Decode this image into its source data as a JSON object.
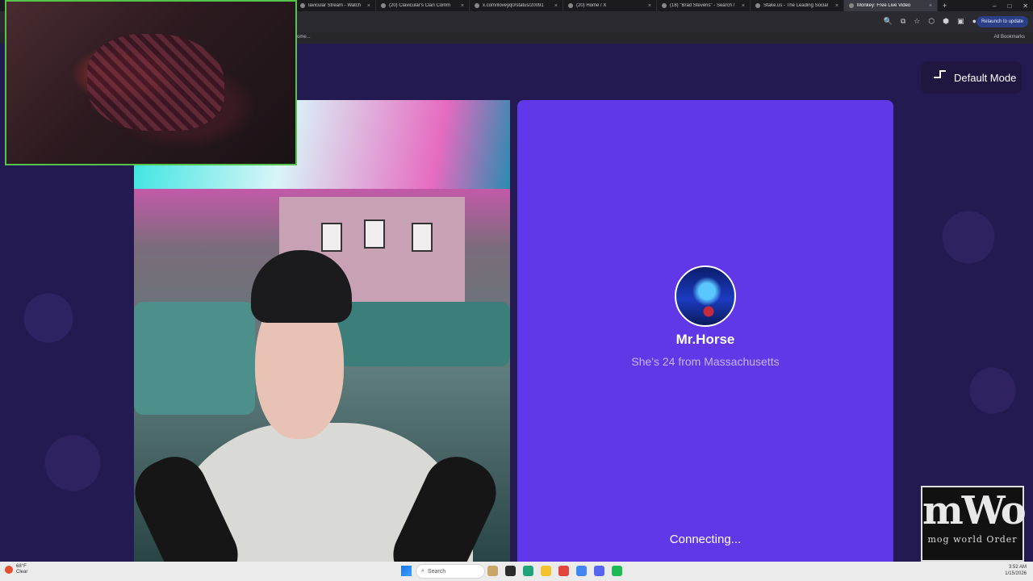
{
  "browser": {
    "tabs": [
      {
        "label": "lavicular Stream - Watch Liv",
        "active": false
      },
      {
        "label": "(20) Clavicular's Clan Comm",
        "active": false
      },
      {
        "label": "x.com/iloveyq0/status/20091",
        "active": false
      },
      {
        "label": "(20) Home / X",
        "active": false
      },
      {
        "label": "(18) \"Brad Stevens\" - Search /",
        "active": false
      },
      {
        "label": "Stake.us - The Leading Social",
        "active": false
      },
      {
        "label": "Monkey: Free Live Video",
        "active": true
      }
    ],
    "new_tab_label": "+",
    "relaunch_label": "Relaunch to update",
    "bookmarks_left": "ome...",
    "bookmarks_right": "All Bookmarks"
  },
  "panel": {
    "username": "Mr.Horse",
    "bio": "She's 24 from Massachusetts",
    "status": "Connecting..."
  },
  "mode_button": {
    "label": "Default Mode"
  },
  "logo": {
    "main": "mWo",
    "sub": "mog world Order"
  },
  "taskbar": {
    "weather_temp": "68°F",
    "weather_desc": "Clear",
    "search_placeholder": "Search",
    "time": "3:52 AM",
    "date": "1/15/2026"
  },
  "colors": {
    "page_bg": "#231a52",
    "panel_bg": "#6038e8",
    "facecam_border": "#55c44a"
  }
}
